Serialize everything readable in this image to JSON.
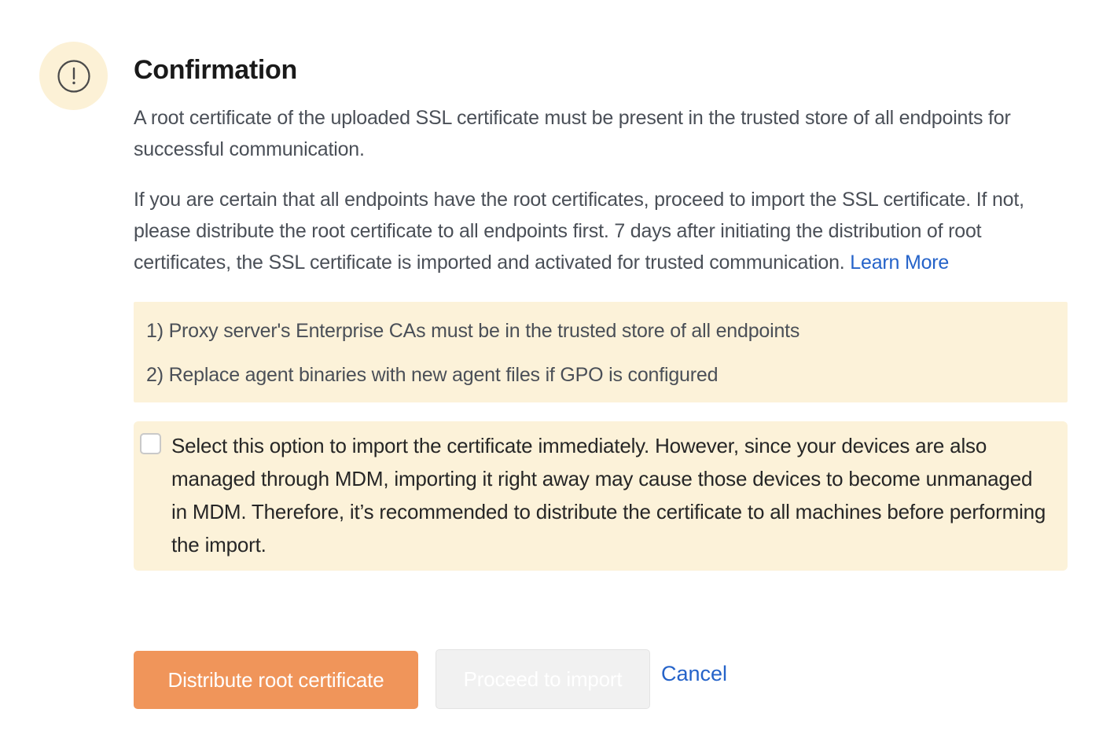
{
  "dialog": {
    "title": "Confirmation",
    "paragraph1": "A root certificate of the uploaded SSL certificate must be present in the trusted store of all endpoints for successful communication.",
    "paragraph2": "If you are certain that all endpoints have the root certificates, proceed to import the SSL certificate. If not, please distribute the root certificate to all endpoints first. 7 days after initiating the distribution of root certificates, the SSL certificate is imported and activated for trusted communication.",
    "learn_more": "Learn More",
    "notes": [
      "1) Proxy server's Enterprise CAs must be in the trusted store of all endpoints",
      "2) Replace agent binaries with new agent files if GPO is configured"
    ],
    "option": {
      "checked": false,
      "label": "Select this option to import the certificate immediately. However, since your devices are also managed through MDM, importing it right away may cause those devices to become unmanaged in MDM. Therefore, it’s recommended to distribute the certificate to all machines before performing the import."
    },
    "buttons": {
      "distribute": "Distribute root certificate",
      "proceed": "Proceed to import",
      "cancel": "Cancel"
    }
  },
  "icons": {
    "alert": "exclamation-circle-icon"
  },
  "colors": {
    "accent": "#f0955a",
    "link": "#2563c9",
    "highlight_bg": "#fcf2d9",
    "icon_bg": "#fcf1d6"
  }
}
